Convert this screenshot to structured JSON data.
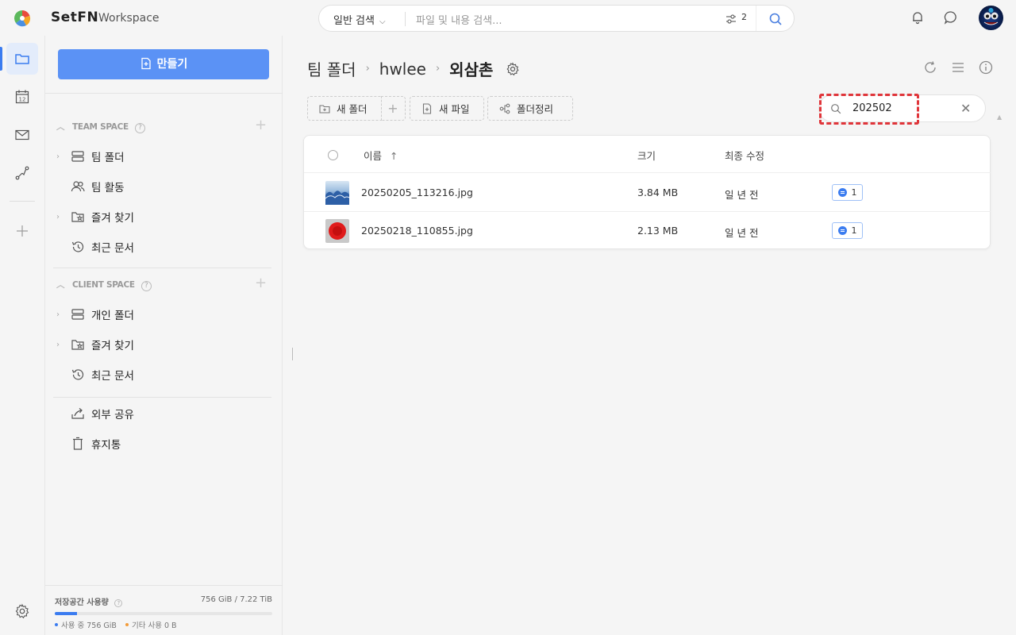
{
  "app": {
    "brand": "SetFN",
    "brand_sub": "Workspace"
  },
  "search": {
    "type_label": "일반 검색",
    "placeholder": "파일 및 내용 검색...",
    "filter_count": "2"
  },
  "sidebar": {
    "create_label": "만들기",
    "team_space": {
      "header": "TEAM SPACE",
      "items": [
        {
          "label": "팀 폴더",
          "icon": "server-icon"
        },
        {
          "label": "팀 활동",
          "icon": "people-icon"
        },
        {
          "label": "즐겨 찾기",
          "icon": "star-folder-icon"
        },
        {
          "label": "최근 문서",
          "icon": "history-icon"
        }
      ]
    },
    "client_space": {
      "header": "CLIENT SPACE",
      "items": [
        {
          "label": "개인 폴더",
          "icon": "server-icon"
        },
        {
          "label": "즐겨 찾기",
          "icon": "star-folder-icon"
        },
        {
          "label": "최근 문서",
          "icon": "history-icon"
        }
      ]
    },
    "extra": [
      {
        "label": "외부 공유",
        "icon": "share-icon"
      },
      {
        "label": "휴지통",
        "icon": "trash-icon"
      }
    ],
    "storage": {
      "label": "저장공간 사용량",
      "total": "756 GiB / 7.22 TiB",
      "used_label": "사용 중 756 GiB",
      "other_label": "기타 사용 0 B",
      "used_fraction": 0.102,
      "used_color": "#3b7cf0",
      "other_color": "#f39c3a"
    }
  },
  "breadcrumb": [
    "팀 폴더",
    "hwlee",
    "외삼촌"
  ],
  "toolbar": {
    "new_folder": "새 폴더",
    "new_file": "새 파일",
    "organize": "폴더정리"
  },
  "filter": {
    "value": "202502"
  },
  "table": {
    "columns": {
      "name": "이름",
      "size": "크기",
      "modified": "최종 수정"
    },
    "sort_indicator": "↑",
    "rows": [
      {
        "name": "20250205_113216.jpg",
        "size": "3.84 MB",
        "modified": "일 년 전",
        "comments": "1"
      },
      {
        "name": "20250218_110855.jpg",
        "size": "2.13 MB",
        "modified": "일 년 전",
        "comments": "1"
      }
    ]
  }
}
